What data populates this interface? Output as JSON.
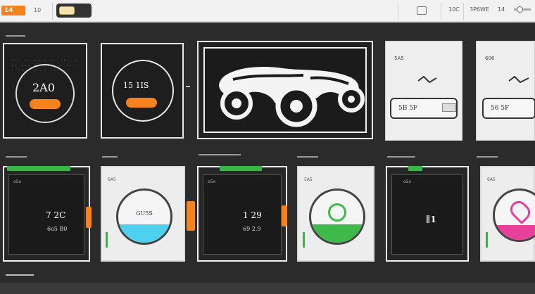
{
  "toolbar": {
    "badge_label": "14",
    "mini_label": "10",
    "view_label": "10C",
    "zoom_label": "3P6WE",
    "page_label": "14"
  },
  "row1": {
    "gauge1": {
      "value": "2A0",
      "button": ""
    },
    "gauge2": {
      "value": "15 1IS",
      "button": ""
    },
    "hero": {
      "alt": "vehicle-illustration"
    },
    "panel1": {
      "tag": "5A5",
      "field": "5B 5F"
    },
    "panel2": {
      "tag": "606",
      "field": "56 5F"
    }
  },
  "cards": [
    {
      "tag": "ɢ5ʌ",
      "value": "7 2C",
      "sub": "6ɢ5 B0"
    },
    {
      "tag": "6A5",
      "gauge_label": "GU5S",
      "fill": 0.35,
      "fill_color": "#4fd0ef"
    },
    {
      "tag": "ɢ5ʌ",
      "value": "1 29",
      "sub": "69 2.9"
    },
    {
      "tag": "5A5",
      "gauge_label": "",
      "fill": 0.35,
      "fill_color": "#3fb94a"
    },
    {
      "tag": "ɢ5ʌ",
      "value": "∥1",
      "sub": ""
    },
    {
      "tag": "6A5",
      "gauge_label": "",
      "fill": 0.3,
      "fill_color": "#e8409a"
    }
  ],
  "colors": {
    "accent": "#f5821f",
    "green": "#39b54a",
    "dark": "#1e1e1e"
  }
}
